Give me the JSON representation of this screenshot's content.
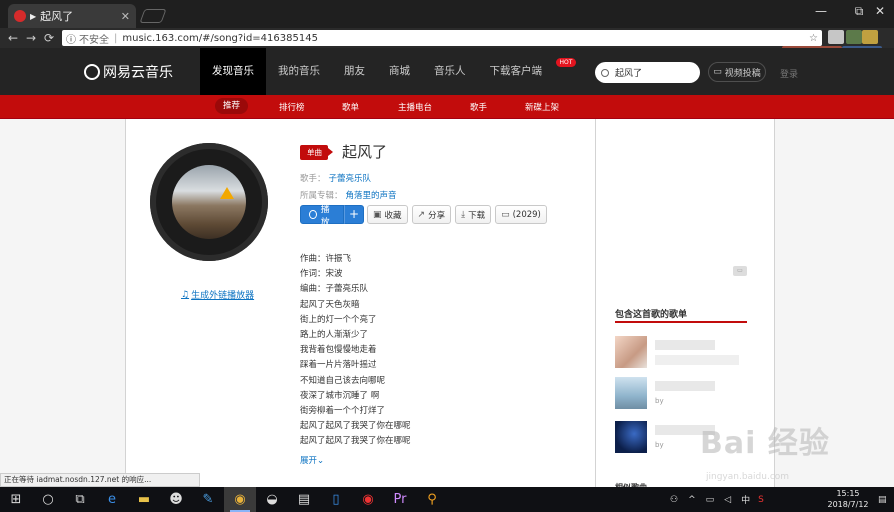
{
  "browser": {
    "tab_title": "起风了",
    "tab_close": "✕",
    "url_security": "不安全",
    "url": "music.163.com/#/song?id=416385145",
    "back": "←",
    "forward": "→",
    "reload": "⟳",
    "win_min": "—",
    "win_max": "⧉",
    "win_close": "✕"
  },
  "header": {
    "logo_text": "网易云音乐",
    "nav": [
      {
        "label": "发现音乐",
        "active": true
      },
      {
        "label": "我的音乐",
        "active": false
      },
      {
        "label": "朋友",
        "active": false
      },
      {
        "label": "商城",
        "active": false
      },
      {
        "label": "音乐人",
        "active": false
      },
      {
        "label": "下载客户端",
        "active": false
      }
    ],
    "hot_badge": "HOT",
    "search_value": "起风了",
    "creator_label": "视频投稿",
    "login_label": "登录"
  },
  "subnav": [
    "推荐",
    "排行榜",
    "歌单",
    "主播电台",
    "歌手",
    "新碟上架"
  ],
  "song": {
    "tag": "单曲",
    "title": "起风了",
    "singer_label": "歌手：",
    "singer": "子蕾亮乐队",
    "album_label": "所属专辑：",
    "album": "角落里的声音",
    "play_label": "播放",
    "add_label": "+",
    "collect_label": "收藏",
    "share_label": "分享",
    "download_label": "下载",
    "comment_label": "(2029)",
    "ext_player_label": "生成外链播放器",
    "expand_label": "展开",
    "lyrics": [
      "作曲：许振飞",
      "作词：宋波",
      "编曲：子蕾亮乐队",
      "起风了天色灰暗",
      "街上的灯一个个亮了",
      "路上的人渐渐少了",
      "我背着包慢慢地走着",
      "踩着一片片落叶摇过",
      "不知道自己该去向哪呢",
      "夜深了城市沉睡了 啊",
      "街旁柳着一个个打烊了",
      "起风了起风了我哭了你在哪呢",
      "起风了起风了我哭了你在哪呢"
    ]
  },
  "sidebar": {
    "playlists_title": "包含这首歌的歌单",
    "playlist_by": [
      "by",
      "by",
      "by"
    ],
    "similar_title": "相似歌曲"
  },
  "status_bar": "正在等待 iadmat.nosdn.127.net 的响应...",
  "taskbar": {
    "time": "15:15",
    "date": "2018/7/12",
    "ime": "中"
  },
  "watermark": {
    "main": "Bai 经验",
    "sub": "jingyan.baidu.com"
  }
}
